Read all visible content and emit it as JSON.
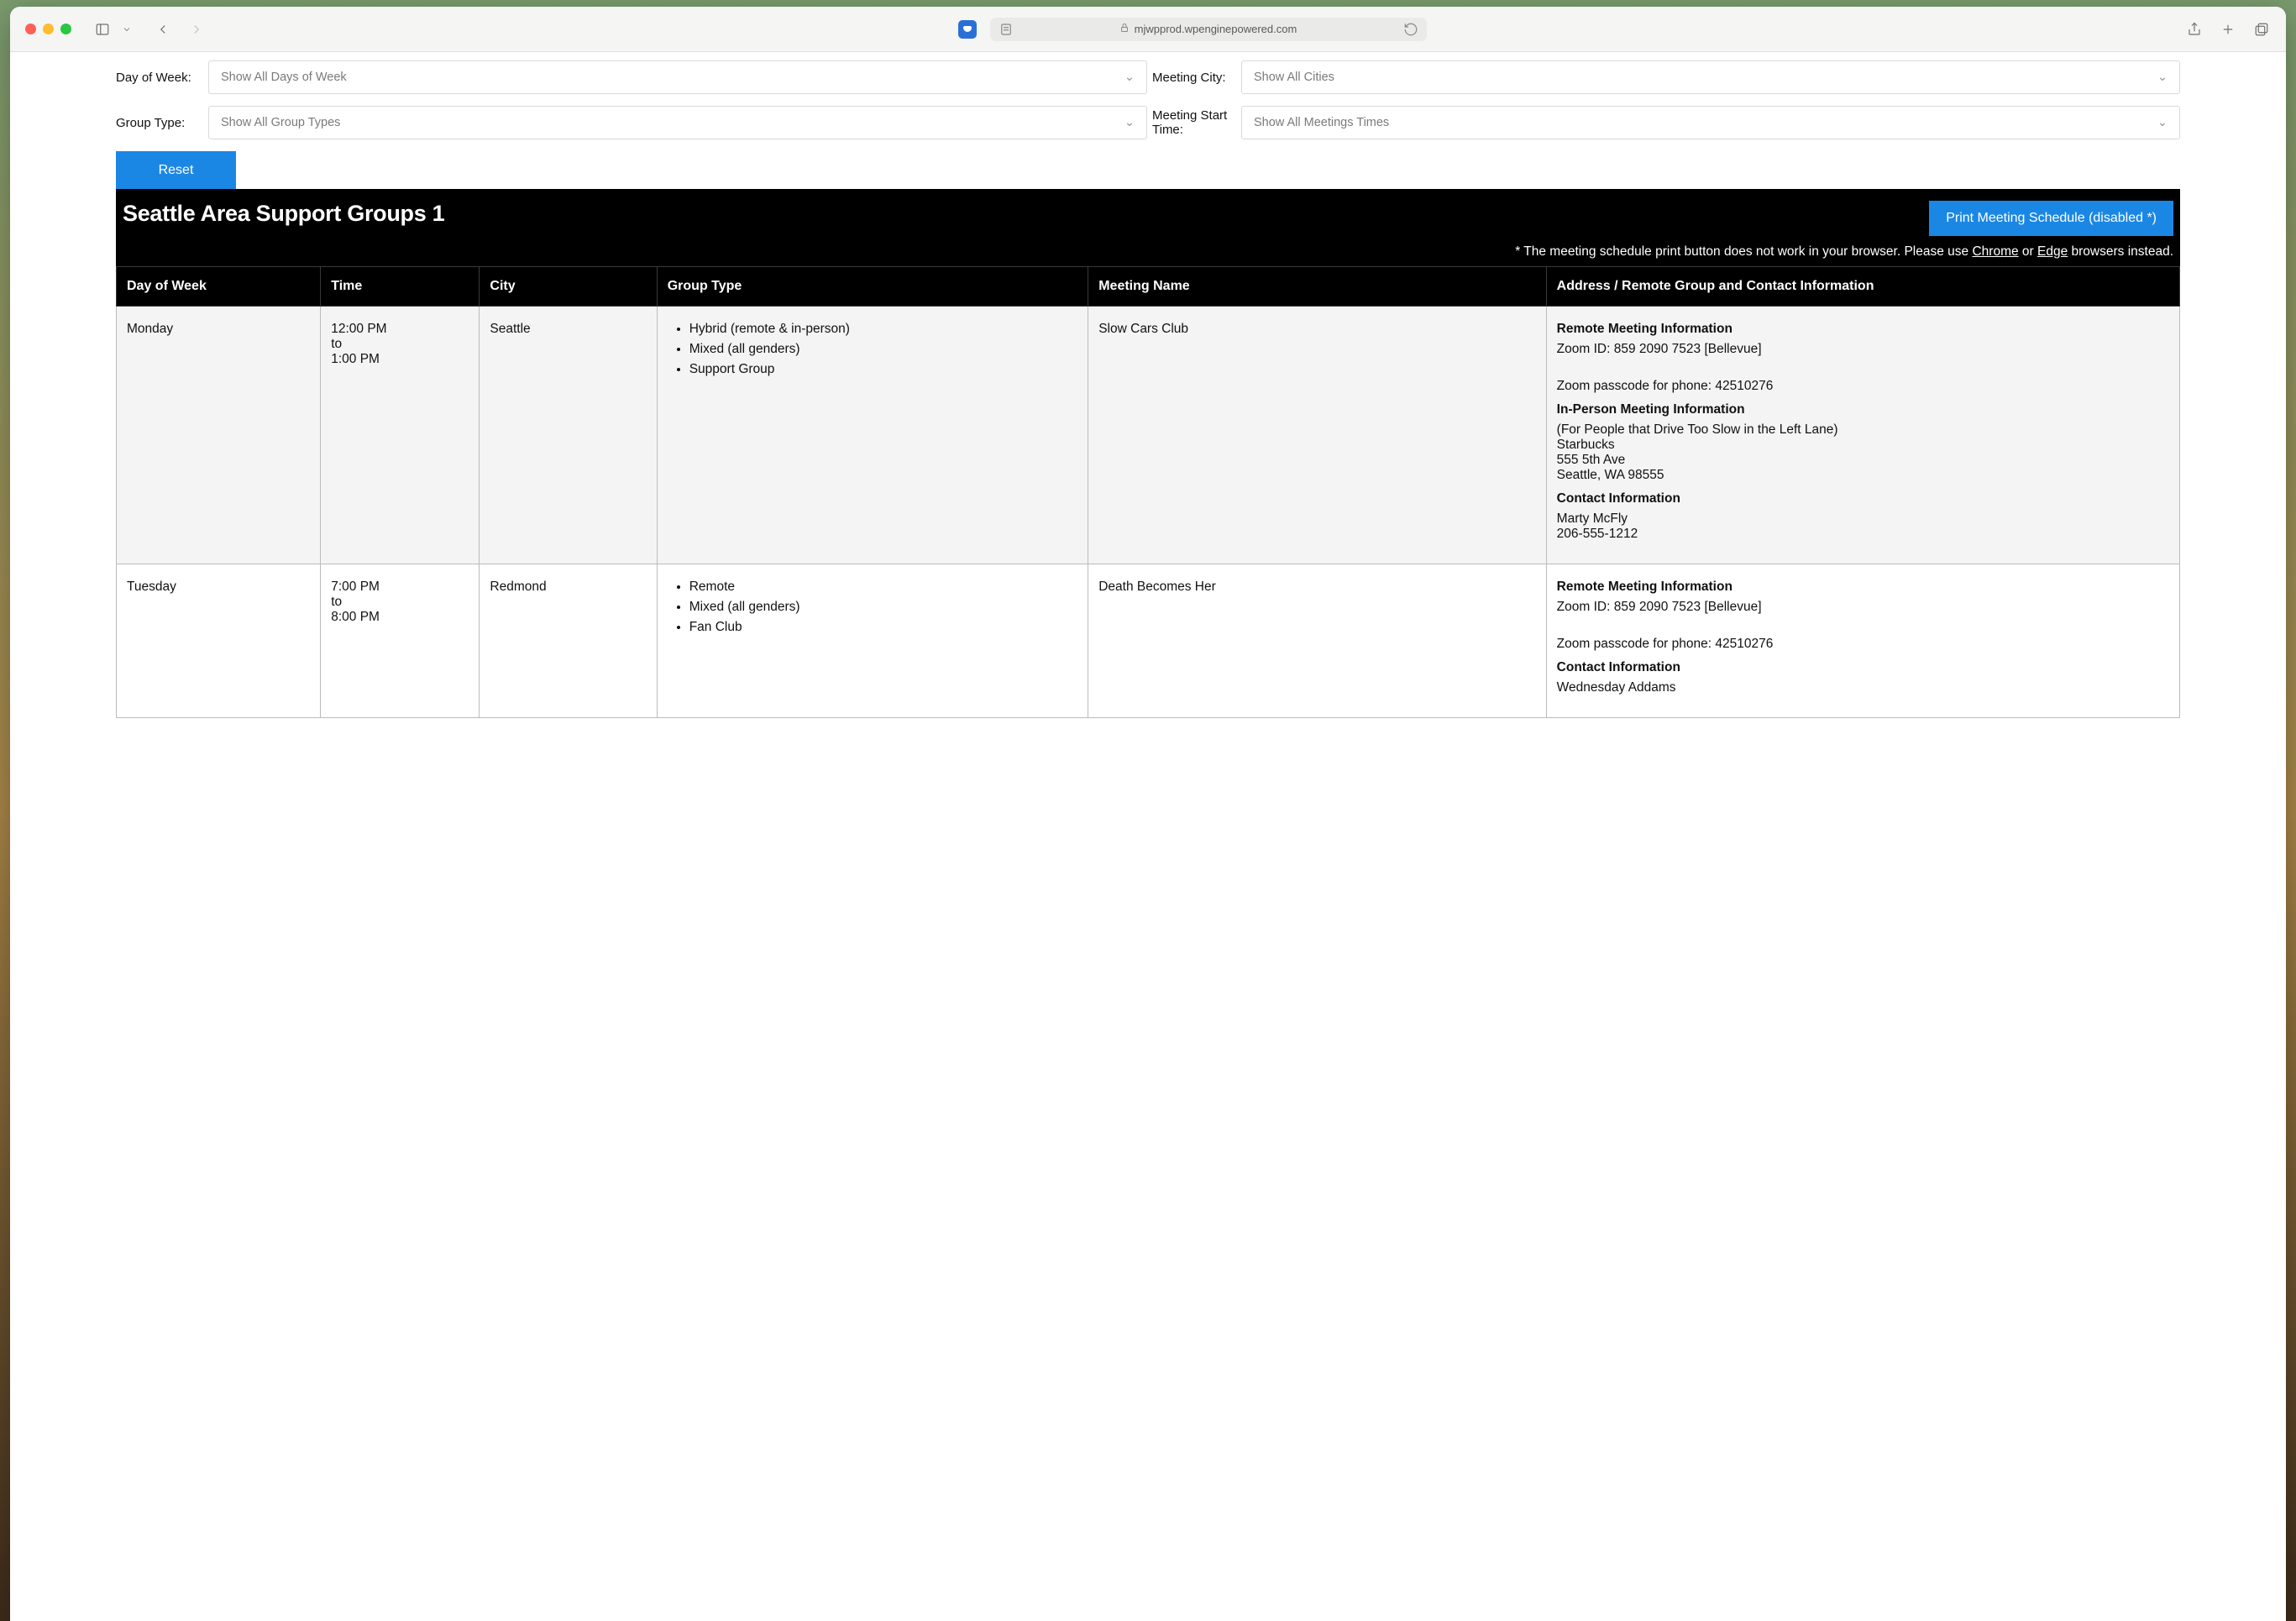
{
  "browser": {
    "url_domain": "mjwpprod.wpenginepowered.com"
  },
  "filters": {
    "day_label": "Day of Week:",
    "day_value": "Show All Days of Week",
    "city_label": "Meeting City:",
    "city_value": "Show All Cities",
    "group_label": "Group Type:",
    "group_value": "Show All Group Types",
    "start_label": "Meeting Start Time:",
    "start_value": "Show All Meetings Times",
    "reset_label": "Reset"
  },
  "header": {
    "title": "Seattle Area Support Groups 1",
    "print_button": "Print Meeting Schedule (disabled *)",
    "note_prefix": "* The meeting schedule print button does not work in your browser. Please use ",
    "note_link1": "Chrome",
    "note_or": " or ",
    "note_link2": "Edge",
    "note_suffix": " browsers instead."
  },
  "columns": {
    "c0": "Day of Week",
    "c1": "Time",
    "c2": "City",
    "c3": "Group Type",
    "c4": "Meeting Name",
    "c5": "Address / Remote Group and Contact Information"
  },
  "rows": [
    {
      "day": "Monday",
      "time": "12:00 PM\nto\n1:00 PM",
      "city": "Seattle",
      "types": [
        "Hybrid (remote & in-person)",
        "Mixed (all genders)",
        "Support Group"
      ],
      "name": "Slow Cars Club",
      "addr": {
        "remote_hdr": "Remote Meeting Information",
        "zoom_id": "Zoom ID: 859 2090 7523 [Bellevue]",
        "zoom_pass": "Zoom passcode for phone: 42510276",
        "inperson_hdr": "In-Person Meeting Information",
        "inperson_lines": [
          "(For People that Drive Too Slow in the Left Lane)",
          "Starbucks",
          "555 5th Ave",
          "Seattle, WA 98555"
        ],
        "contact_hdr": "Contact Information",
        "contact_lines": [
          "Marty McFly",
          "206-555-1212"
        ]
      }
    },
    {
      "day": "Tuesday",
      "time": "7:00 PM\nto\n8:00 PM",
      "city": "Redmond",
      "types": [
        "Remote",
        "Mixed (all genders)",
        "Fan Club"
      ],
      "name": "Death Becomes Her",
      "addr": {
        "remote_hdr": "Remote Meeting Information",
        "zoom_id": "Zoom ID: 859 2090 7523 [Bellevue]",
        "zoom_pass": "Zoom passcode for phone: 42510276",
        "contact_hdr": "Contact Information",
        "contact_lines": [
          "Wednesday Addams"
        ]
      }
    }
  ]
}
